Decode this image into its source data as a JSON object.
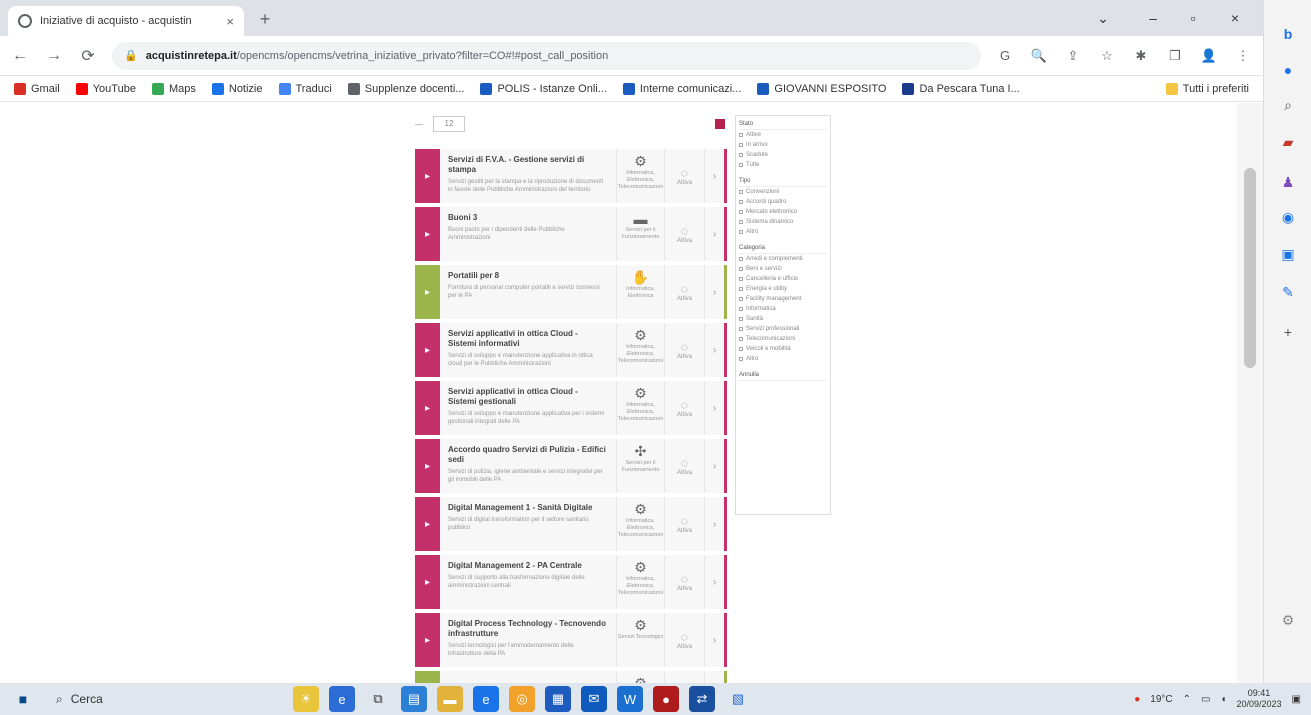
{
  "browser": {
    "tab_title": "Iniziative di acquisto - acquistin",
    "tab_close": "×",
    "new_tab": "+",
    "window": {
      "dropdown": "⌄",
      "minimize": "–",
      "maximize": "▫",
      "close": "×"
    },
    "nav": {
      "back": "←",
      "forward": "→",
      "reload": "⟳"
    },
    "url_host": "acquistinretepa.it",
    "url_path": "/opencms/opencms/vetrina_iniziative_privato?filter=CO#!#post_call_position",
    "toolbar_icons": [
      "G",
      "🔍",
      "⇪",
      "☆",
      "✱",
      "❐",
      "👤",
      "⋮"
    ]
  },
  "bookmarks": [
    {
      "label": "Gmail",
      "color": "#d93025"
    },
    {
      "label": "YouTube",
      "color": "#ff0000"
    },
    {
      "label": "Maps",
      "color": "#34a853"
    },
    {
      "label": "Notizie",
      "color": "#1a73e8"
    },
    {
      "label": "Traduci",
      "color": "#4285f4"
    },
    {
      "label": "Supplenze docenti...",
      "color": "#5f6368"
    },
    {
      "label": "POLIS - Istanze Onli...",
      "color": "#1a5bbf"
    },
    {
      "label": "Interne comunicazi...",
      "color": "#1a5bbf"
    },
    {
      "label": "GIOVANNI ESPOSITO",
      "color": "#1a5bbf"
    },
    {
      "label": "Da Pescara Tuna I...",
      "color": "#1a3a8a"
    }
  ],
  "bookmarks_right": "Tutti i preferiti",
  "page": {
    "per_page": "12",
    "cards": [
      {
        "title": "Servizi di F.V.A. - Gestione servizi di stampa",
        "desc": "Servizi gestiti per la stampa e la riproduzione di documenti in favore delle Pubbliche Amministrazioni del territorio",
        "cat": "Informatica, Elettronica, Telecomunicazioni",
        "state": "Attiva",
        "color": "#c3306a",
        "glyph": "⚙"
      },
      {
        "title": "Buoni 3",
        "desc": "Buoni pasto per i dipendenti delle Pubbliche Amministrazioni",
        "cat": "Servizi per il Funzionamento",
        "state": "Attiva",
        "color": "#c3306a",
        "glyph": "▬"
      },
      {
        "title": "Portatili per 8",
        "desc": "Fornitura di personal computer portatili e servizi connessi per le PA",
        "cat": "Informatica, Elettronica",
        "state": "Attiva",
        "color": "#9cb54a",
        "glyph": "✋"
      },
      {
        "title": "Servizi applicativi in ottica Cloud - Sistemi informativi",
        "desc": "Servizi di sviluppo e manutenzione applicativa in ottica cloud per le Pubbliche Amministrazioni",
        "cat": "Informatica, Elettronica, Telecomunicazioni",
        "state": "Attiva",
        "color": "#c3306a",
        "glyph": "⚙"
      },
      {
        "title": "Servizi applicativi in ottica Cloud - Sistemi gestionali",
        "desc": "Servizi di sviluppo e manutenzione applicativa per i sistemi gestionali integrati delle PA",
        "cat": "Informatica, Elettronica, Telecomunicazioni",
        "state": "Attiva",
        "color": "#c3306a",
        "glyph": "⚙"
      },
      {
        "title": "Accordo quadro Servizi di Pulizia - Edifici sedi",
        "desc": "Servizi di pulizia, igiene ambientale e servizi integrativi per gli immobili delle PA",
        "cat": "Servizi per il Funzionamento",
        "state": "Attiva",
        "color": "#c3306a",
        "glyph": "✣"
      },
      {
        "title": "Digital Management 1 - Sanità Digitale",
        "desc": "Servizi di digital transformation per il settore sanitario pubblico",
        "cat": "Informatica, Elettronica, Telecomunicazioni",
        "state": "Attiva",
        "color": "#c3306a",
        "glyph": "⚙"
      },
      {
        "title": "Digital Management 2 - PA Centrale",
        "desc": "Servizi di supporto alla trasformazione digitale delle amministrazioni centrali",
        "cat": "Informatica, Elettronica, Telecomunicazioni",
        "state": "Attiva",
        "color": "#c3306a",
        "glyph": "⚙"
      },
      {
        "title": "Digital Process Technology - Tecnovendo infrastrutture",
        "desc": "Servizi tecnologici per l'ammodernamento delle infrastrutture della PA",
        "cat": "Servizi Tecnologici",
        "state": "Attiva",
        "color": "#c3306a",
        "glyph": "⚙"
      },
      {
        "title": "",
        "desc": "",
        "cat": "",
        "state": "",
        "color": "#9cb54a",
        "glyph": "⚙"
      }
    ],
    "filters": [
      {
        "title": "Stato",
        "items": [
          "Attive",
          "In arrivo",
          "Scadute",
          "Tutte"
        ]
      },
      {
        "title": "Tipo",
        "items": [
          "Convenzioni",
          "Accordi quadro",
          "Mercato elettronico",
          "Sistema dinamico",
          "Altro"
        ]
      },
      {
        "title": "Categoria",
        "items": [
          "Arredi e complementi",
          "Beni e servizi",
          "Cancelleria e ufficio",
          "Energia e utility",
          "Facility management",
          "Informatica",
          "Sanità",
          "Servizi professionali",
          "Telecomunicazioni",
          "Veicoli e mobilità",
          "Altro"
        ]
      }
    ],
    "filter_reset": "Annulla"
  },
  "taskbar": {
    "search_placeholder": "Cerca",
    "weather": "19°C",
    "time": "09:41",
    "date": "20/09/2023"
  }
}
